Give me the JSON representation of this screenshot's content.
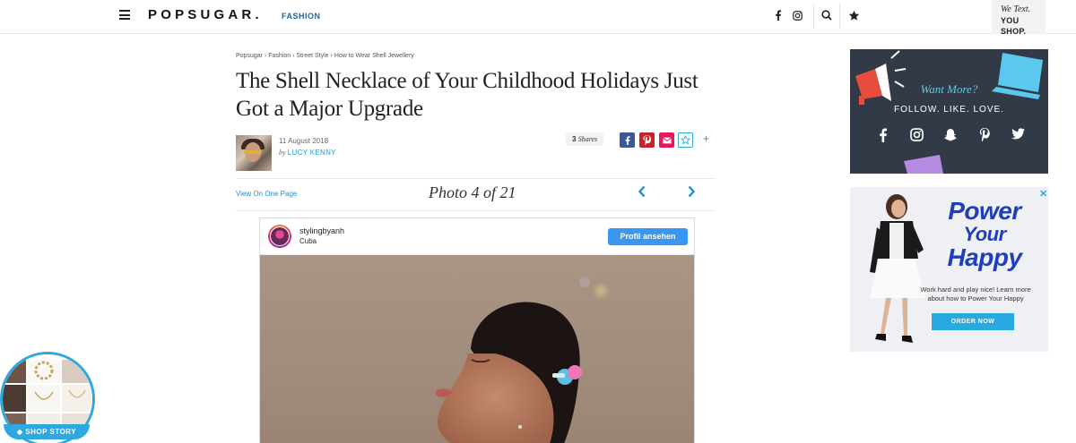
{
  "header": {
    "logo": "POPSUGAR.",
    "section": "FASHION",
    "promo_line1": "We Text.",
    "promo_line2": "YOU SHOP."
  },
  "breadcrumbs": [
    "Popsugar",
    "Fashion",
    "Street Style",
    "How to Wear Shell Jewellery"
  ],
  "breadcrumb_sep": "›",
  "article": {
    "title": "The Shell Necklace of Your Childhood Holidays Just Got a Major Upgrade",
    "date": "11 August 2018",
    "by": "by",
    "author": "LUCY KENNY",
    "shares_count": "3",
    "shares_label": "Shares"
  },
  "gallery": {
    "view_one_page": "View On One Page",
    "photo_counter": "Photo 4 of 21",
    "prev": "‹",
    "next": "›"
  },
  "instagram": {
    "username": "stylingbyanh",
    "location": "Cuba",
    "profile_button": "Profil ansehen"
  },
  "sidebar_ad1": {
    "headline": "Want More?",
    "subline": "FOLLOW. LIKE. LOVE."
  },
  "sidebar_ad2": {
    "headline_lines": [
      "Power",
      "Your",
      "Happy"
    ],
    "body": "Work hard and play nice! Learn more about how to Power Your Happy",
    "cta": "ORDER NOW",
    "close": "✕"
  },
  "shop_story": {
    "label": "SHOP STORY"
  },
  "colors": {
    "brand_blue": "#1c6aa5",
    "link_blue": "#1c8fd0",
    "instagram_blue": "#3897f0",
    "ad_dark": "#333a47",
    "facebook": "#3b5998",
    "pinterest": "#cb2027",
    "email": "#e8175d"
  }
}
